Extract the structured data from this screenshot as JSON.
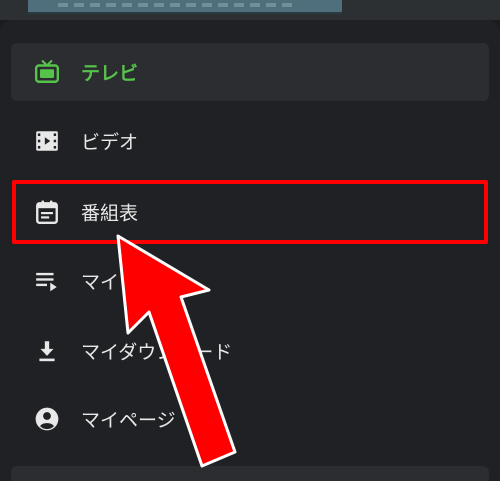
{
  "menu": {
    "items": [
      {
        "label": "テレビ",
        "icon": "tv-icon",
        "active": true
      },
      {
        "label": "ビデオ",
        "icon": "video-icon",
        "active": false
      },
      {
        "label": "番組表",
        "icon": "calendar-icon",
        "active": false
      },
      {
        "label": "マイリスト",
        "icon": "playlist-icon",
        "active": false
      },
      {
        "label": "マイダウンロード",
        "icon": "download-icon",
        "active": false
      },
      {
        "label": "マイページ",
        "icon": "account-icon",
        "active": false
      }
    ]
  },
  "colors": {
    "accent": "#56c44a",
    "highlight": "#ff0000",
    "background": "#202124",
    "active_bg": "#2c2d30",
    "text": "#e8e8e8"
  }
}
